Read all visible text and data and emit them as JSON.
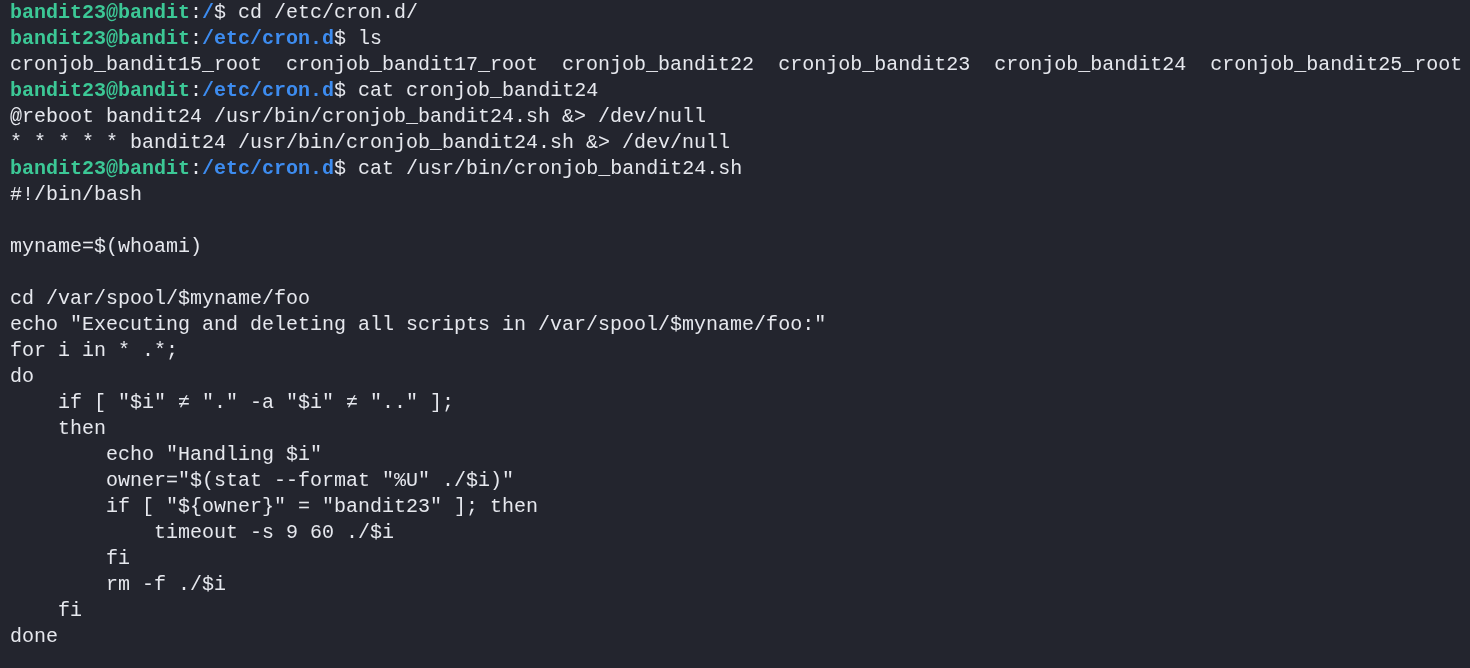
{
  "terminal": {
    "lines": [
      {
        "kind": "prompt",
        "user": "bandit23@bandit",
        "separator": ":",
        "path": "/",
        "symbol": "$",
        "command": "cd /etc/cron.d/"
      },
      {
        "kind": "prompt",
        "user": "bandit23@bandit",
        "separator": ":",
        "path": "/etc/cron.d",
        "symbol": "$",
        "command": "ls"
      },
      {
        "kind": "output",
        "text": "cronjob_bandit15_root  cronjob_bandit17_root  cronjob_bandit22  cronjob_bandit23  cronjob_bandit24  cronjob_bandit25_root"
      },
      {
        "kind": "prompt",
        "user": "bandit23@bandit",
        "separator": ":",
        "path": "/etc/cron.d",
        "symbol": "$",
        "command": "cat cronjob_bandit24"
      },
      {
        "kind": "output",
        "text": "@reboot bandit24 /usr/bin/cronjob_bandit24.sh &> /dev/null"
      },
      {
        "kind": "output",
        "text": "* * * * * bandit24 /usr/bin/cronjob_bandit24.sh &> /dev/null"
      },
      {
        "kind": "prompt",
        "user": "bandit23@bandit",
        "separator": ":",
        "path": "/etc/cron.d",
        "symbol": "$",
        "command": "cat /usr/bin/cronjob_bandit24.sh"
      },
      {
        "kind": "output",
        "text": "#!/bin/bash"
      },
      {
        "kind": "blank"
      },
      {
        "kind": "output",
        "text": "myname=$(whoami)"
      },
      {
        "kind": "blank"
      },
      {
        "kind": "output",
        "text": "cd /var/spool/$myname/foo"
      },
      {
        "kind": "output",
        "text": "echo \"Executing and deleting all scripts in /var/spool/$myname/foo:\""
      },
      {
        "kind": "output",
        "text": "for i in * .*;"
      },
      {
        "kind": "output",
        "text": "do"
      },
      {
        "kind": "output",
        "text": "    if [ \"$i\" ≠ \".\" -a \"$i\" ≠ \"..\" ];"
      },
      {
        "kind": "output",
        "text": "    then"
      },
      {
        "kind": "output",
        "text": "        echo \"Handling $i\""
      },
      {
        "kind": "output",
        "text": "        owner=\"$(stat --format \"%U\" ./$i)\""
      },
      {
        "kind": "output",
        "text": "        if [ \"${owner}\" = \"bandit23\" ]; then"
      },
      {
        "kind": "output",
        "text": "            timeout -s 9 60 ./$i"
      },
      {
        "kind": "output",
        "text": "        fi"
      },
      {
        "kind": "output",
        "text": "        rm -f ./$i"
      },
      {
        "kind": "output",
        "text": "    fi"
      },
      {
        "kind": "output",
        "text": "done"
      }
    ]
  }
}
